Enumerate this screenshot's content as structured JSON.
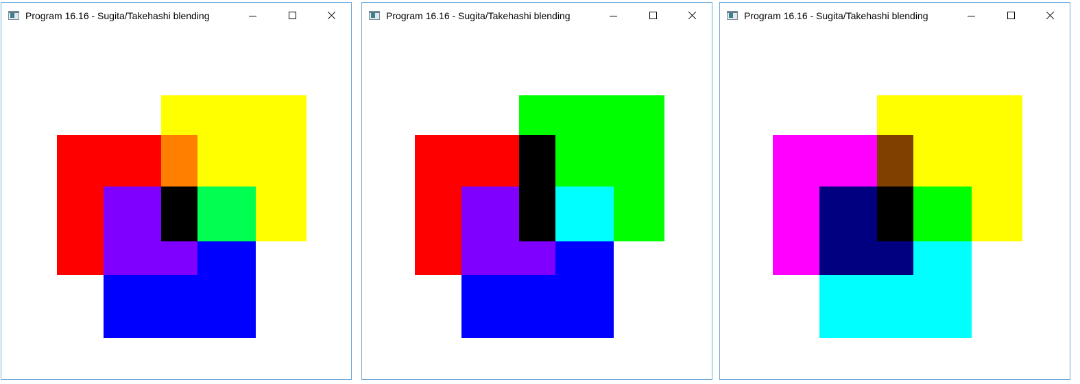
{
  "windows": [
    {
      "title": "Program 16.16 - Sugita/Takehashi blending",
      "colors": {
        "rect_a": "#ffff00",
        "rect_b": "#ff0000",
        "rect_c": "#0000ff",
        "overlap_ab": "#ff8000",
        "overlap_bc": "#8000ff",
        "overlap_ac": "#00ff50",
        "overlap_abc": "#000000"
      }
    },
    {
      "title": "Program 16.16 - Sugita/Takehashi blending",
      "colors": {
        "rect_a": "#00ff00",
        "rect_b": "#ff0000",
        "rect_c": "#0000ff",
        "overlap_ab": "#000000",
        "overlap_bc": "#8000ff",
        "overlap_ac": "#00ffff",
        "overlap_abc": "#000000"
      }
    },
    {
      "title": "Program 16.16 - Sugita/Takehashi blending",
      "colors": {
        "rect_a": "#ffff00",
        "rect_b": "#ff00ff",
        "rect_c": "#00ffff",
        "overlap_ab": "#804000",
        "overlap_bc": "#000080",
        "overlap_ac": "#00ff00",
        "overlap_abc": "#000000"
      }
    }
  ]
}
